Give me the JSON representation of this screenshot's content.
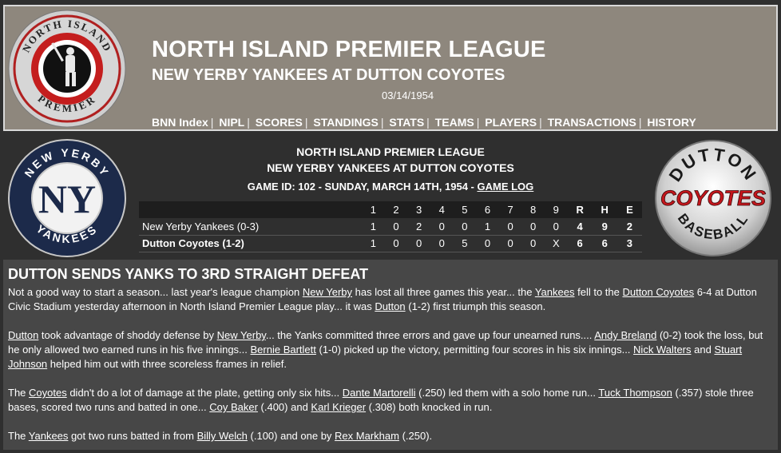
{
  "header": {
    "title": "NORTH ISLAND PREMIER LEAGUE",
    "subtitle": "NEW YERBY YANKEES AT DUTTON COYOTES",
    "date": "03/14/1954",
    "logo_text": "NORTH ISLAND PREMIER",
    "nav": [
      "BNN Index",
      "NIPL",
      "SCORES",
      "STANDINGS",
      "STATS",
      "TEAMS",
      "PLAYERS",
      "TRANSACTIONS",
      "HISTORY"
    ]
  },
  "summary": {
    "league": "NORTH ISLAND PREMIER LEAGUE",
    "matchup": "NEW YERBY YANKEES AT DUTTON COYOTES",
    "game_id_text": "GAME ID: 102 - SUNDAY, MARCH 14TH, 1954 - ",
    "game_log_label": "GAME LOG"
  },
  "logos": {
    "away": {
      "top_text": "NEW YERBY",
      "bottom_text": "YANKEES"
    },
    "home": {
      "top_text": "DUTTON",
      "middle_text": "COYOTES",
      "bottom_text": "BASEBALL"
    }
  },
  "linescore": {
    "headers": [
      "1",
      "2",
      "3",
      "4",
      "5",
      "6",
      "7",
      "8",
      "9",
      "R",
      "H",
      "E"
    ],
    "away": {
      "team": "New Yerby Yankees (0-3)",
      "innings": [
        "1",
        "0",
        "2",
        "0",
        "0",
        "1",
        "0",
        "0",
        "0"
      ],
      "r": "4",
      "h": "9",
      "e": "2"
    },
    "home": {
      "team": "Dutton Coyotes (1-2)",
      "innings": [
        "1",
        "0",
        "0",
        "0",
        "5",
        "0",
        "0",
        "0",
        "X"
      ],
      "r": "6",
      "h": "6",
      "e": "3"
    }
  },
  "article": {
    "headline": "DUTTON SENDS YANKS TO 3RD STRAIGHT DEFEAT",
    "paragraphs": [
      [
        {
          "t": "Not a good way to start a season... last year's league champion "
        },
        {
          "t": "New Yerby",
          "link": true
        },
        {
          "t": " has lost all three games this year... the "
        },
        {
          "t": "Yankees",
          "link": true
        },
        {
          "t": " fell to the "
        },
        {
          "t": "Dutton Coyotes",
          "link": true
        },
        {
          "t": " 6-4 at Dutton Civic Stadium yesterday afternoon in North Island Premier League play... it was "
        },
        {
          "t": "Dutton",
          "link": true
        },
        {
          "t": " (1-2) first triumph this season."
        }
      ],
      [
        {
          "t": "Dutton",
          "link": true
        },
        {
          "t": " took advantage of shoddy defense by "
        },
        {
          "t": "New Yerby",
          "link": true
        },
        {
          "t": "... the Yanks committed three errors and gave up four unearned runs.... "
        },
        {
          "t": "Andy Breland",
          "link": true
        },
        {
          "t": " (0-2) took the loss, but he only allowed two earned runs in his five innings... "
        },
        {
          "t": "Bernie Bartlett",
          "link": true
        },
        {
          "t": " (1-0) picked up the victory, permitting four scores in his six innings... "
        },
        {
          "t": "Nick Walters",
          "link": true
        },
        {
          "t": " and "
        },
        {
          "t": "Stuart Johnson",
          "link": true
        },
        {
          "t": " helped him out with three scoreless frames in relief."
        }
      ],
      [
        {
          "t": "The "
        },
        {
          "t": "Coyotes",
          "link": true
        },
        {
          "t": " didn't do a lot of damage at the plate, getting only six hits... "
        },
        {
          "t": "Dante Martorelli",
          "link": true
        },
        {
          "t": " (.250) led them with a solo home run... "
        },
        {
          "t": "Tuck Thompson",
          "link": true
        },
        {
          "t": " (.357) stole three bases, scored two runs and batted in one... "
        },
        {
          "t": "Coy Baker",
          "link": true
        },
        {
          "t": " (.400) and "
        },
        {
          "t": "Karl Krieger",
          "link": true
        },
        {
          "t": " (.308) both knocked in run."
        }
      ],
      [
        {
          "t": "The "
        },
        {
          "t": "Yankees",
          "link": true
        },
        {
          "t": " got two runs batted in from "
        },
        {
          "t": "Billy Welch",
          "link": true
        },
        {
          "t": " (.100) and one by "
        },
        {
          "t": "Rex Markham",
          "link": true
        },
        {
          "t": " (.250)."
        }
      ]
    ]
  },
  "colors": {
    "banner": "#8e877d",
    "page_bg": "#2f2f2f",
    "article_bg": "#474747",
    "yankees_navy": "#1c2a4a",
    "coyotes_red": "#c4161c"
  }
}
